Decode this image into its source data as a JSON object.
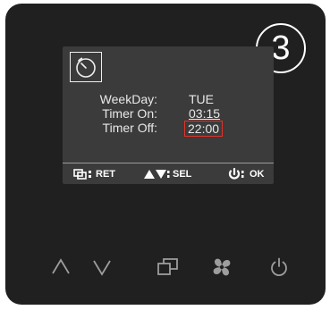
{
  "badge_number": "3",
  "screen": {
    "rows": [
      {
        "label": "WeekDay:",
        "value": "TUE"
      },
      {
        "label": "Timer On:",
        "value": "03:15"
      },
      {
        "label": "Timer Off:",
        "value": "22:00"
      }
    ],
    "softkeys": {
      "ret": "RET",
      "sel": "SEL",
      "ok": "OK"
    }
  },
  "highlight_color": "#e0322a",
  "hardware_buttons": [
    "up-icon",
    "down-icon",
    "mode-icon",
    "fan-icon",
    "power-icon"
  ]
}
